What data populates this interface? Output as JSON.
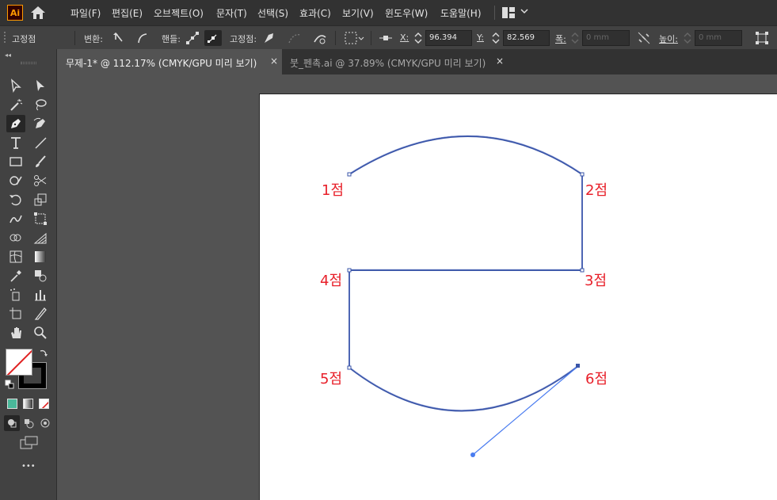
{
  "app": {
    "logo_text": "Ai"
  },
  "menu": [
    "파일(F)",
    "편집(E)",
    "오브젝트(O)",
    "문자(T)",
    "선택(S)",
    "효과(C)",
    "보기(V)",
    "윈도우(W)",
    "도움말(H)"
  ],
  "control_bar": {
    "selection_label": "고정점",
    "convert_label": "변환:",
    "handles_label": "핸들:",
    "anchors_label": "고정점:",
    "x_label": "X:",
    "x_value": "96.394 mm",
    "y_label": "Y:",
    "y_value": "82.569 mm",
    "w_label": "폭:",
    "w_value": "0 mm",
    "h_label": "높이:",
    "h_value": "0 mm"
  },
  "tabs": [
    {
      "label": "무제-1* @ 112.17% (CMYK/GPU 미리 보기)",
      "close": "×",
      "active": true
    },
    {
      "label": "붓_펜촉.ai @ 37.89% (CMYK/GPU 미리 보기)",
      "close": "×",
      "active": false
    }
  ],
  "artboard": {
    "point_labels": [
      "1점",
      "2점",
      "3점",
      "4점",
      "5점",
      "6점"
    ],
    "path_color": "#3a55a8",
    "handle_color": "#4a7cf0",
    "label_color": "#e8202a"
  },
  "toolbar": {
    "more_label": "•••"
  }
}
